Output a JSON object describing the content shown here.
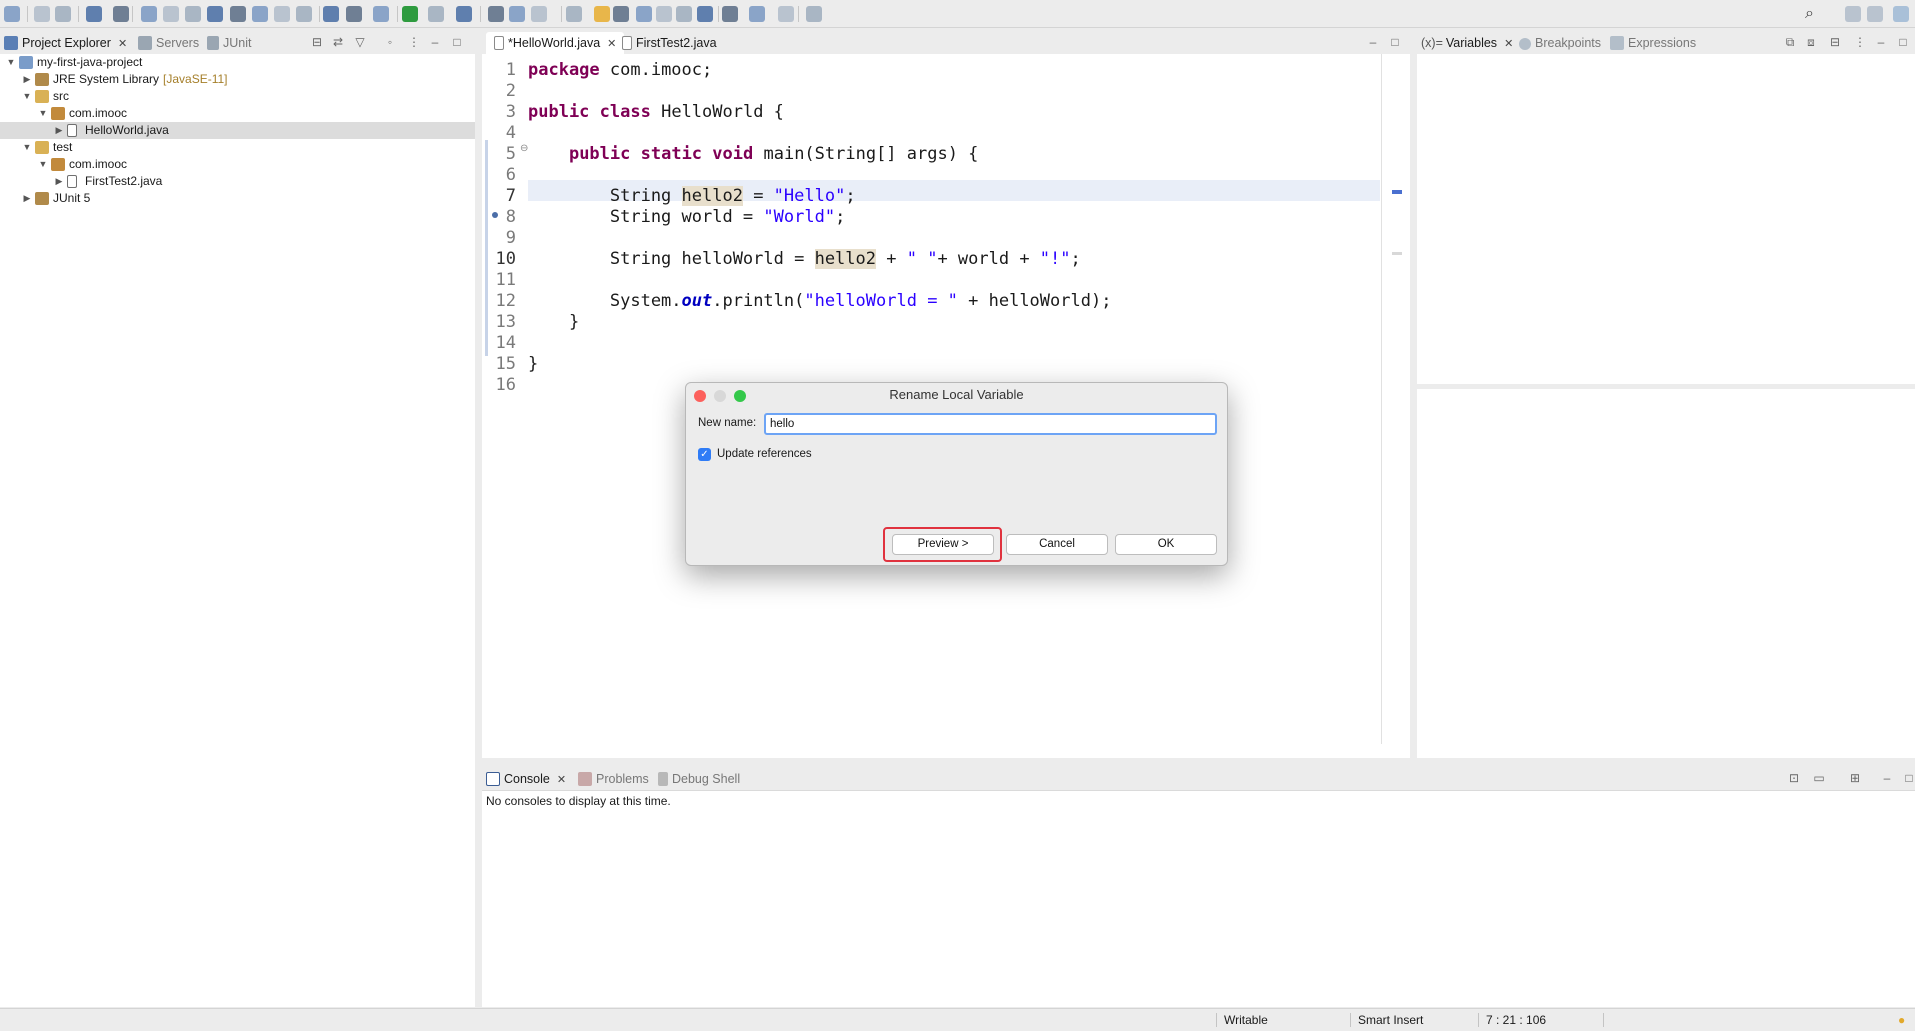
{
  "toolbar": {
    "icons": [
      "new-icon",
      "save-icon",
      "save-all-icon",
      "terminal-icon",
      "pin-icon",
      "skip-icon",
      "suspend-icon",
      "terminate-icon",
      "disconnect-icon",
      "step-into-icon",
      "step-over-icon",
      "step-return-icon",
      "outline-icon",
      "hierarchy-icon",
      "open-type-icon",
      "debug-icon",
      "run-icon",
      "coverage-icon",
      "external-tools-icon",
      "open-folder-icon",
      "open-file-icon",
      "search-icon",
      "mark-occurrences-icon",
      "toggle-highlight-icon",
      "word-wrap-icon",
      "show-whitespace-icon",
      "block-select-icon",
      "pilcrow-icon",
      "next-annotation-icon",
      "prev-annotation-icon",
      "back-icon",
      "forward-icon",
      "perspective-icon"
    ],
    "right_icons": [
      "search-icon",
      "open-perspective-icon",
      "java-perspective-icon",
      "debug-perspective-icon"
    ]
  },
  "explorer": {
    "tabs": [
      {
        "label": "Project Explorer",
        "icon": "project-explorer-icon",
        "active": true
      },
      {
        "label": "Servers",
        "icon": "servers-icon",
        "active": false
      },
      {
        "label": "JUnit",
        "icon": "junit-icon",
        "active": false
      }
    ],
    "tree": [
      {
        "label": "my-first-java-project",
        "level": 0,
        "expanded": true,
        "icon": "project-icon"
      },
      {
        "label": "JRE System Library",
        "decoration": "[JavaSE-11]",
        "level": 1,
        "expanded": false,
        "icon": "library-icon"
      },
      {
        "label": "src",
        "level": 1,
        "expanded": true,
        "icon": "source-folder-icon"
      },
      {
        "label": "com.imooc",
        "level": 2,
        "expanded": true,
        "icon": "package-icon"
      },
      {
        "label": "HelloWorld.java",
        "level": 3,
        "expanded": false,
        "icon": "java-file-icon",
        "selected": true
      },
      {
        "label": "test",
        "level": 1,
        "expanded": true,
        "icon": "source-folder-icon"
      },
      {
        "label": "com.imooc",
        "level": 2,
        "expanded": true,
        "icon": "package-icon"
      },
      {
        "label": "FirstTest2.java",
        "level": 3,
        "expanded": false,
        "icon": "java-file-icon"
      },
      {
        "label": "JUnit 5",
        "level": 1,
        "expanded": false,
        "icon": "library-icon"
      }
    ]
  },
  "editor": {
    "tabs": [
      {
        "label": "*HelloWorld.java",
        "active": true
      },
      {
        "label": "FirstTest2.java",
        "active": false
      }
    ],
    "lines": [
      {
        "n": "1",
        "tokens": [
          {
            "t": "package",
            "c": "kw"
          },
          {
            "t": " com.imooc;",
            "c": ""
          }
        ]
      },
      {
        "n": "2",
        "tokens": []
      },
      {
        "n": "3",
        "tokens": [
          {
            "t": "public",
            "c": "kw"
          },
          {
            "t": " ",
            "c": ""
          },
          {
            "t": "class",
            "c": "kw"
          },
          {
            "t": " HelloWorld {",
            "c": ""
          }
        ]
      },
      {
        "n": "4",
        "tokens": []
      },
      {
        "n": "5",
        "tokens": [
          {
            "t": "    ",
            "c": ""
          },
          {
            "t": "public",
            "c": "kw"
          },
          {
            "t": " ",
            "c": ""
          },
          {
            "t": "static",
            "c": "kw"
          },
          {
            "t": " ",
            "c": ""
          },
          {
            "t": "void",
            "c": "kw"
          },
          {
            "t": " main(String[] args) {",
            "c": ""
          }
        ]
      },
      {
        "n": "6",
        "tokens": []
      },
      {
        "n": "7",
        "tokens": [
          {
            "t": "        String ",
            "c": ""
          },
          {
            "t": "hello2",
            "c": "hl"
          },
          {
            "t": " = ",
            "c": ""
          },
          {
            "t": "\"Hello\"",
            "c": "str"
          },
          {
            "t": ";",
            "c": ""
          }
        ]
      },
      {
        "n": "8",
        "tokens": [
          {
            "t": "        String world = ",
            "c": ""
          },
          {
            "t": "\"World\"",
            "c": "str"
          },
          {
            "t": ";",
            "c": ""
          }
        ]
      },
      {
        "n": "9",
        "tokens": []
      },
      {
        "n": "10",
        "tokens": [
          {
            "t": "        String helloWorld = ",
            "c": ""
          },
          {
            "t": "hello2",
            "c": "hl"
          },
          {
            "t": " + ",
            "c": ""
          },
          {
            "t": "\" \"",
            "c": "str"
          },
          {
            "t": "+ world + ",
            "c": ""
          },
          {
            "t": "\"!\"",
            "c": "str"
          },
          {
            "t": ";",
            "c": ""
          }
        ]
      },
      {
        "n": "11",
        "tokens": []
      },
      {
        "n": "12",
        "tokens": [
          {
            "t": "        System.",
            "c": ""
          },
          {
            "t": "out",
            "c": "fld"
          },
          {
            "t": ".println(",
            "c": ""
          },
          {
            "t": "\"helloWorld = \"",
            "c": "str"
          },
          {
            "t": " + helloWorld);",
            "c": ""
          }
        ]
      },
      {
        "n": "13",
        "tokens": [
          {
            "t": "    }",
            "c": ""
          }
        ]
      },
      {
        "n": "14",
        "tokens": []
      },
      {
        "n": "15",
        "tokens": [
          {
            "t": "}",
            "c": ""
          }
        ]
      },
      {
        "n": "16",
        "tokens": []
      }
    ]
  },
  "variables": {
    "tabs": [
      {
        "label": "Variables",
        "prefix": "(x)=",
        "active": true
      },
      {
        "label": "Breakpoints",
        "active": false
      },
      {
        "label": "Expressions",
        "active": false
      }
    ]
  },
  "console": {
    "tabs": [
      {
        "label": "Console",
        "active": true
      },
      {
        "label": "Problems",
        "active": false
      },
      {
        "label": "Debug Shell",
        "active": false
      }
    ],
    "message": "No consoles to display at this time."
  },
  "status": {
    "writable": "Writable",
    "insert_mode": "Smart Insert",
    "position": "7 : 21 : 106"
  },
  "dialog": {
    "title": "Rename Local Variable",
    "new_name_label": "New name:",
    "new_name_value": "hello",
    "update_references_label": "Update references",
    "update_references_checked": true,
    "buttons": {
      "preview": "Preview >",
      "cancel": "Cancel",
      "ok": "OK"
    }
  },
  "colors": {
    "keyword": "#7f0055",
    "string": "#2a00ff",
    "highlight": "#e8dfcc",
    "focus_ring": "#e0323e",
    "input_focus": "#6da4f5"
  }
}
